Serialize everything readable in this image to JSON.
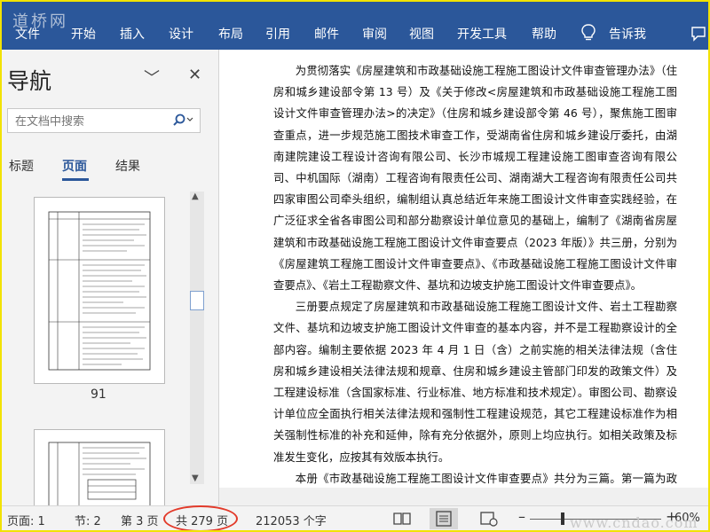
{
  "watermark_top": "道桥网",
  "watermark_bottom": "www.cndao.com",
  "ribbon": {
    "tabs": [
      "文件",
      "开始",
      "插入",
      "设计",
      "布局",
      "引用",
      "邮件",
      "审阅",
      "视图",
      "开发工具",
      "帮助"
    ],
    "tell_me": "告诉我"
  },
  "nav": {
    "title": "导航",
    "search_placeholder": "在文档中搜索",
    "tabs": [
      "标题",
      "页面",
      "结果"
    ],
    "page_number": "91"
  },
  "document": {
    "paragraphs": [
      "为贯彻落实《房屋建筑和市政基础设施工程施工图设计文件审查管理办法》（住房和城乡建设部令第 13 号）及《关于修改<房屋建筑和市政基础设施工程施工图设计文件审查管理办法>的决定》（住房和城乡建设部令第 46 号），聚焦施工图审查重点，进一步规范施工图技术审查工作，受湖南省住房和城乡建设厅委托，由湖南建院建设工程设计咨询有限公司、长沙市城规工程建设施工图审查咨询有限公司、中机国际（湖南）工程咨询有限责任公司、湖南湖大工程咨询有限责任公司共四家审图公司牵头组织，编制组认真总结近年来施工图设计文件审查实践经验，在广泛征求全省各审图公司和部分勘察设计单位意见的基础上，编制了《湖南省房屋建筑和市政基础设施工程施工图设计文件审查要点（2023 年版）》共三册，分别为《房屋建筑工程施工图设计文件审查要点》、《市政基础设施工程施工图设计文件审查要点》、《岩土工程勘察文件、基坑和边坡支护施工图设计文件审查要点》。",
      "三册要点规定了房屋建筑和市政基础设施工程施工图设计文件、岩土工程勘察文件、基坑和边坡支护施工图设计文件审查的基本内容，并不是工程勘察设计的全部内容。编制主要依据 2023 年 4 月 1 日（含）之前实施的相关法律法规（含住房和城乡建设相关法律法规和规章、住房和城乡建设主管部门印发的政策文件）及工程建设标准（含国家标准、行业标准、地方标准和技术规定）。审图公司、勘察设计单位应全面执行相关法律法规和强制性工程建设规范，其它工程建设标准作为相关强制性标准的补充和延伸，除有充分依据外，原则上均应执行。如相关政策及标准发生变化，应按其有效版本执行。",
      "本册《市政基础设施工程施工图设计文件审查要点》共分为三篇。第一篇为政策性审查要点；第二篇为技术性审查要点，包含给水工程、排水工程、城市环境卫生工程、城市道路工程、城市桥隧工程、燃气工程、热力工程、城市综合管廊、园林景观等内容；"
    ]
  },
  "status": {
    "page": "页面: 1",
    "section": "节: 2",
    "page_of": "第 3 页",
    "total_pages": "共 279 页",
    "word_count": "212053 个字",
    "zoom": "60%",
    "zoom_minus": "–",
    "zoom_plus": "+"
  }
}
